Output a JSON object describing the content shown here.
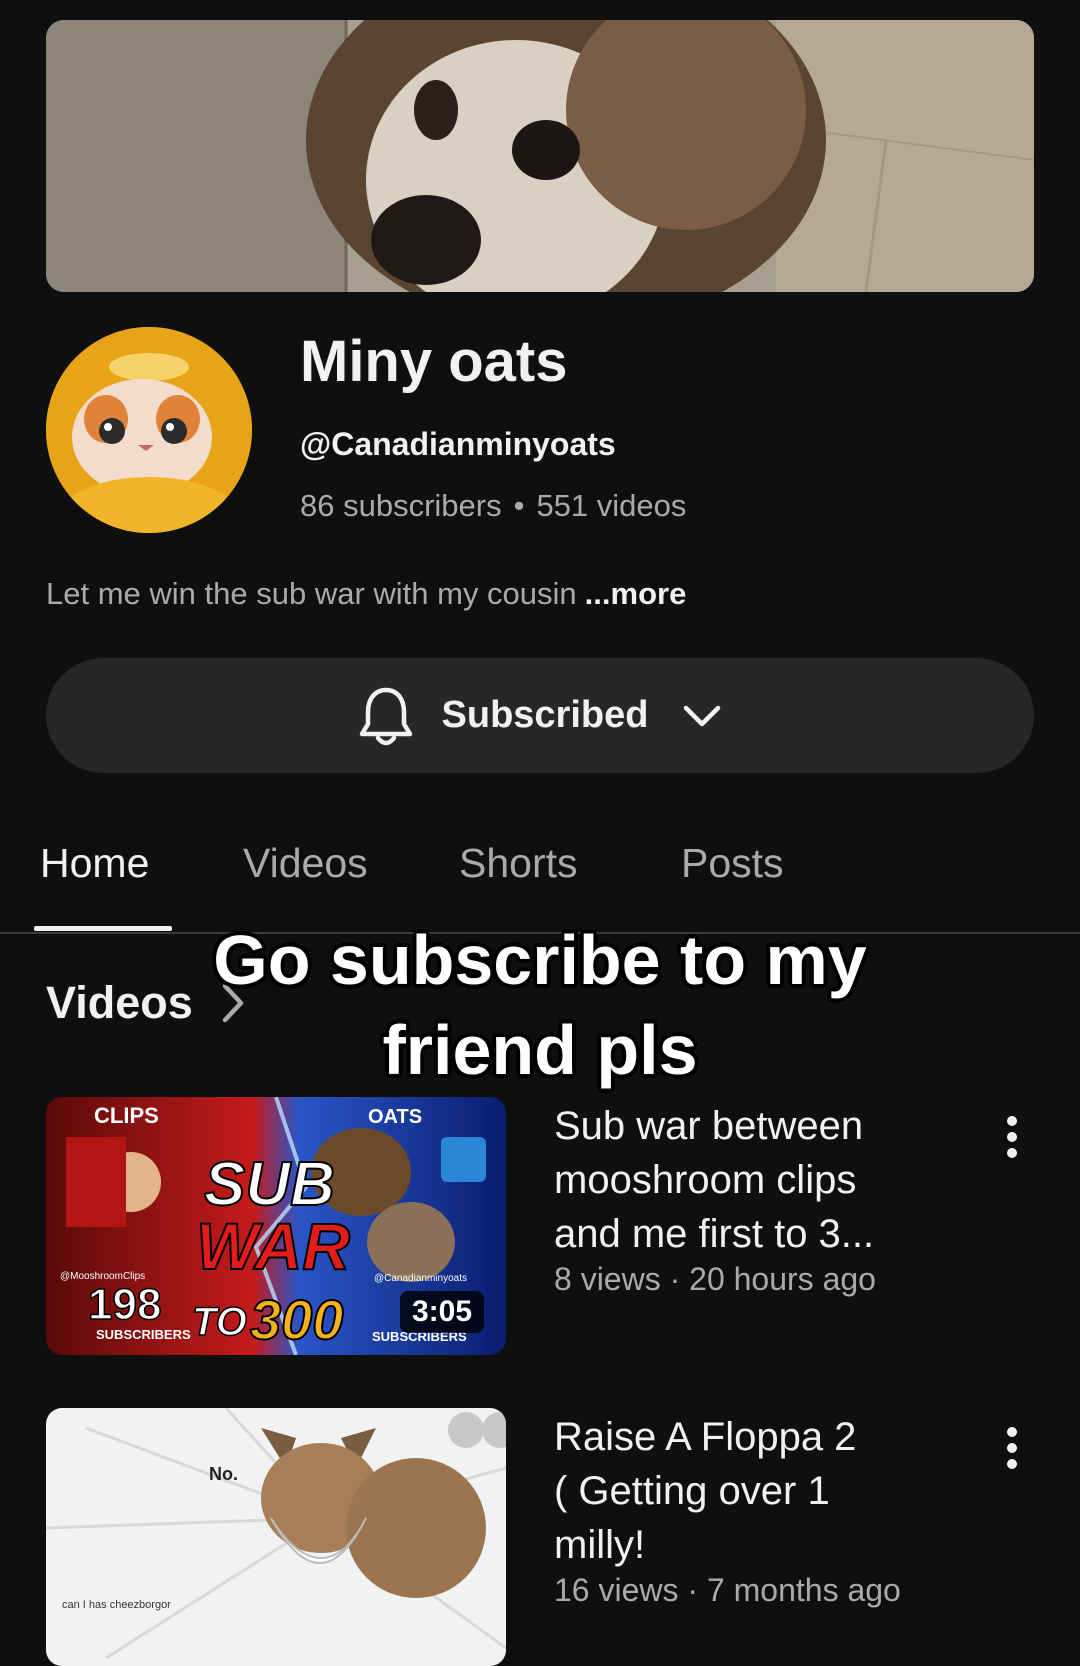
{
  "channel": {
    "name": "Miny oats",
    "handle": "@Canadianminyoats",
    "subscribers": "86 subscribers",
    "separator": "•",
    "videos_count": "551 videos",
    "description": "Let me win the sub war with my cousin",
    "more_label": "...more"
  },
  "subscribe_button": {
    "label": "Subscribed",
    "icon": "bell-icon"
  },
  "tabs": [
    {
      "label": "Home",
      "active": true
    },
    {
      "label": "Videos",
      "active": false
    },
    {
      "label": "Shorts",
      "active": false
    },
    {
      "label": "Posts",
      "active": false
    }
  ],
  "section": {
    "title": "Videos"
  },
  "overlay_caption": {
    "line1": "Go subscribe to my",
    "line2": "friend pls"
  },
  "videos": [
    {
      "title_lines": [
        "Sub war between",
        "mooshroom clips",
        "and me first to 3..."
      ],
      "meta": "8 views · 20 hours ago",
      "duration": "3:05",
      "thumb_text": {
        "top_left": "CLIPS",
        "top_right": "OATS",
        "big1": "SUB",
        "big2": "WAR",
        "small_left": "@MooshroomClips",
        "count": "198",
        "subs_left": "SUBSCRIBERS",
        "to": "TO",
        "target": "300",
        "small_right": "@Canadianminyoats",
        "subs_right": "SUBSCRIBERS"
      }
    },
    {
      "title_lines": [
        "Raise A Floppa 2",
        "( Getting over 1",
        "milly!"
      ],
      "meta": "16 views · 7 months ago",
      "thumb_text": {
        "no": "No.",
        "caption": "can I has cheezborgor"
      }
    }
  ],
  "colors": {
    "background": "#0f0f0f",
    "text": "#f1f1f1",
    "secondary_text": "#aaaaaa",
    "button_bg": "#272727"
  }
}
